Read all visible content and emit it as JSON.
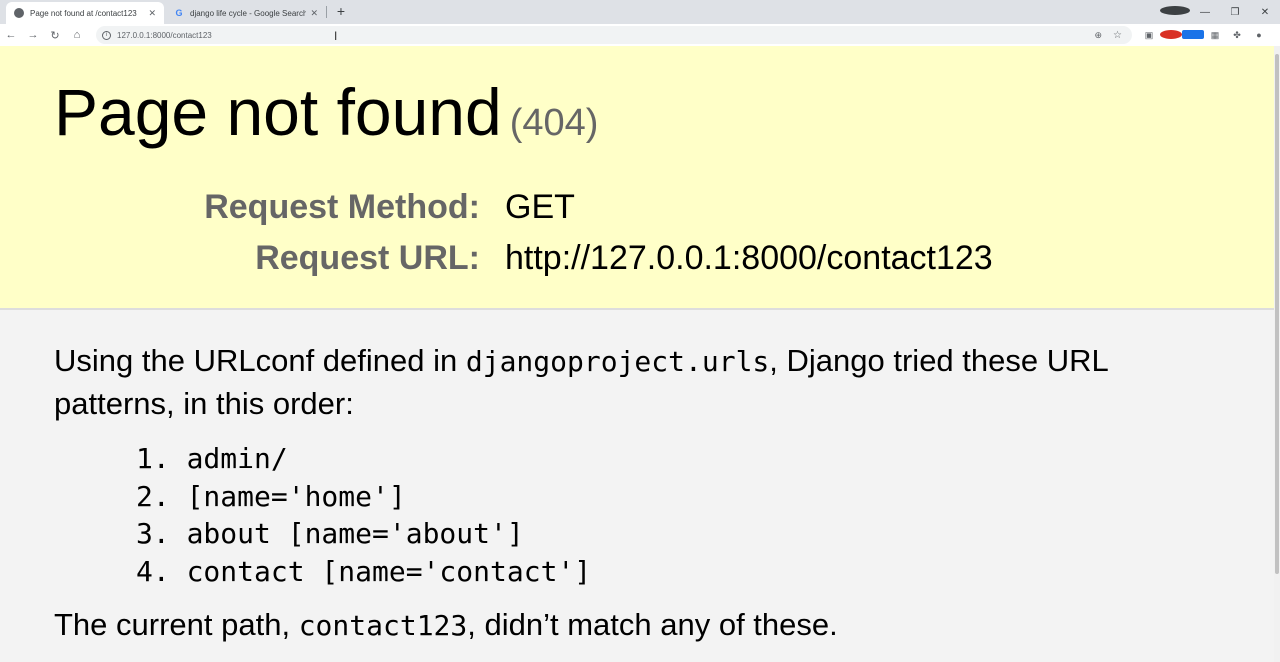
{
  "browser": {
    "tabs": [
      {
        "title": "Page not found at /contact123",
        "active": true,
        "favicon": "globe-icon"
      },
      {
        "title": "django life cycle - Google Search",
        "active": false,
        "favicon": "google-icon"
      }
    ],
    "close_glyph": "✕",
    "new_tab_glyph": "+",
    "url": "127.0.0.1:8000/contact123"
  },
  "error": {
    "title": "Page not found",
    "code": "(404)",
    "method_label": "Request Method:",
    "method_value": "GET",
    "url_label": "Request URL:",
    "url_value": "http://127.0.0.1:8000/contact123"
  },
  "info": {
    "intro_before": "Using the URLconf defined in ",
    "urlconf": "djangoproject.urls",
    "intro_after": ", Django tried these URL patterns, in this order:",
    "patterns": [
      "1. admin/",
      "2. [name='home']",
      "3. about [name='about']",
      "4. contact [name='contact']"
    ],
    "current_before": "The current path, ",
    "current_path": "contact123",
    "current_after": ", didn’t match any of these."
  },
  "colors": {
    "summary_bg": "#ffffc8",
    "info_bg": "#f3f3f3",
    "label_gray": "#666666"
  }
}
